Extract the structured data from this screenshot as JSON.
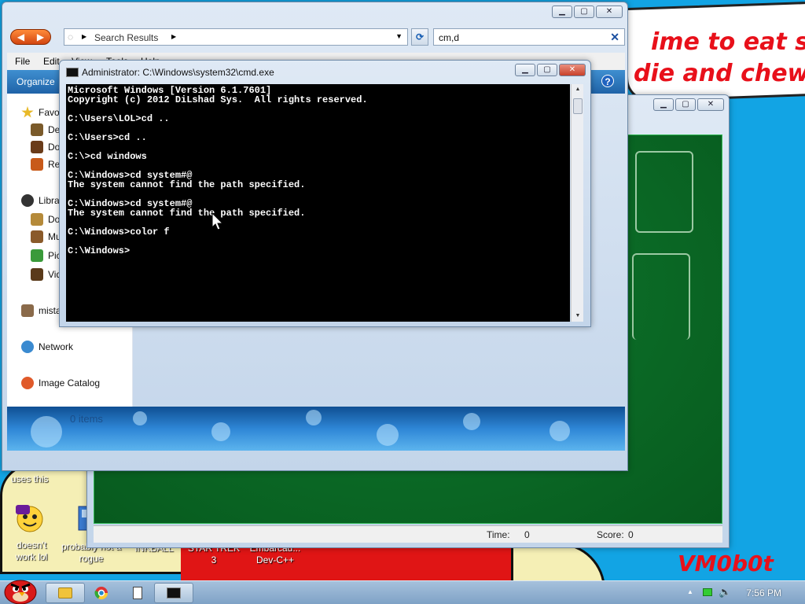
{
  "explorer": {
    "address": "Search Results",
    "search_value": "cm,d",
    "menu": [
      "File",
      "Edit",
      "View",
      "Tools",
      "Help"
    ],
    "organize": "Organize",
    "nav": [
      {
        "label": "Favorites",
        "color": "#e8b928"
      },
      {
        "label": "Desktop",
        "color": "#7a5a2a"
      },
      {
        "label": "Downloads",
        "color": "#6a3c1a"
      },
      {
        "label": "Recent Places",
        "color": "#c85a1a"
      },
      {
        "label": "Libraries",
        "color": "#333333"
      },
      {
        "label": "Documents",
        "color": "#b58a3a"
      },
      {
        "label": "Music",
        "color": "#8a5a2a"
      },
      {
        "label": "Pictures",
        "color": "#3a9a3a"
      },
      {
        "label": "Videos",
        "color": "#5a3a1a"
      },
      {
        "label": "mista",
        "color": "#8a6a4a"
      },
      {
        "label": "Network",
        "color": "#3a8ad0"
      },
      {
        "label": "Image Catalog",
        "color": "#e05a2a"
      }
    ],
    "items_count": "0 items"
  },
  "cmd": {
    "title": "Administrator: C:\\Windows\\system32\\cmd.exe",
    "lines": [
      "Microsoft Windows [Version 6.1.7601]",
      "Copyright (c) 2012 DiLshad Sys.  All rights reserved.",
      "",
      "C:\\Users\\LOL>cd ..",
      "",
      "C:\\Users>cd ..",
      "",
      "C:\\>cd windows",
      "",
      "C:\\Windows>cd system#@",
      "The system cannot find the path specified.",
      "",
      "C:\\Windows>cd system#@",
      "The system cannot find the path specified.",
      "",
      "C:\\Windows>color f",
      "",
      "C:\\Windows>"
    ]
  },
  "solitaire": {
    "time_label": "Time:",
    "time_value": "0",
    "score_label": "Score:",
    "score_value": "0"
  },
  "desktop": {
    "wallpaper_lines": [
      "ime to eat shit",
      "die and chew"
    ],
    "uses_this": "uses this",
    "icons": [
      {
        "label": "doesn't work lol"
      },
      {
        "label": "probably not a rogue"
      },
      {
        "label": "INKBALL"
      },
      {
        "label": "STAR TREK 3"
      },
      {
        "label": "Embarcad... Dev-C++"
      }
    ],
    "signature": "VM0b0t"
  },
  "taskbar": {
    "clock": "7:56 PM"
  },
  "colors": {
    "desktop_blue": "#12a4e4",
    "wallpaper_red": "#e8101a",
    "felt_green": "#0f7a2e",
    "cmd_bg": "#000000"
  }
}
